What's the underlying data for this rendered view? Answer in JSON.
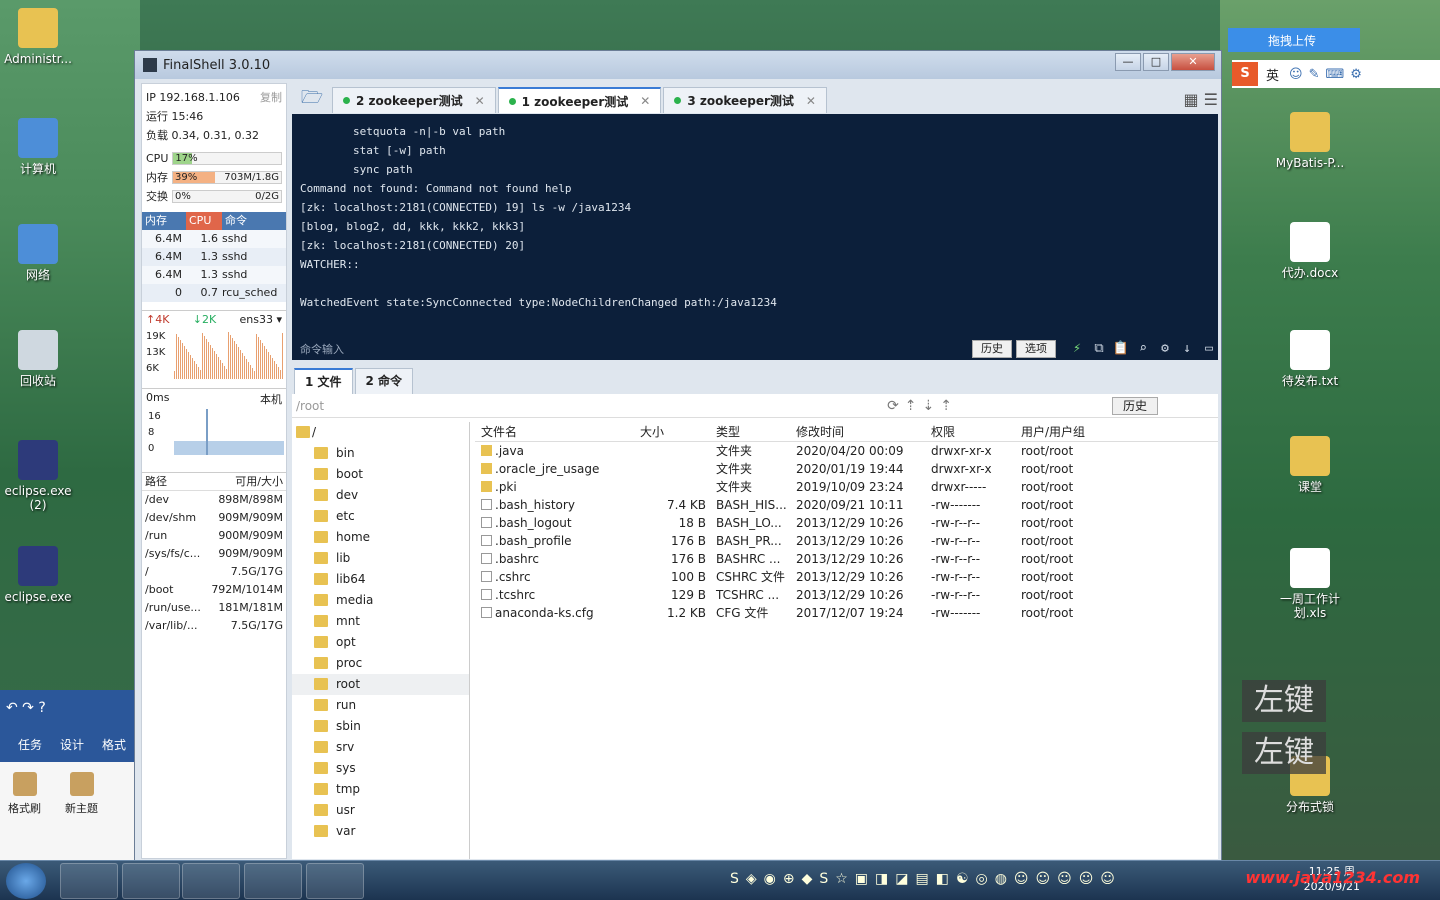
{
  "desktop": {
    "left_icons": [
      {
        "name": "user-folder-icon",
        "label": "Administr..."
      },
      {
        "name": "computer-icon",
        "label": "计算机"
      },
      {
        "name": "network-icon",
        "label": "网络"
      },
      {
        "name": "recycle-bin-icon",
        "label": "回收站"
      },
      {
        "name": "eclipse-icon",
        "label": "eclipse.exe (2)"
      },
      {
        "name": "eclipse-icon",
        "label": "eclipse.exe"
      }
    ],
    "right_icons": [
      {
        "name": "folder-icon",
        "label": "MyBatis-P..."
      },
      {
        "name": "word-doc-icon",
        "label": "代办.docx"
      },
      {
        "name": "text-file-icon",
        "label": "待发布.txt"
      },
      {
        "name": "folder-icon",
        "label": "课堂"
      },
      {
        "name": "spreadsheet-icon",
        "label": "一周工作计划.xls"
      },
      {
        "name": "folder-icon",
        "label": "分布式锁"
      }
    ],
    "baidu_label": "拖拽上传",
    "ime_label": "英",
    "overlay_text": "左键"
  },
  "window": {
    "title": "FinalShell 3.0.10",
    "controls": {
      "min": "—",
      "max": "□",
      "close": "✕"
    }
  },
  "sysinfo": {
    "ip": "IP 192.168.1.106",
    "copy": "复制",
    "uptime": "运行 15:46",
    "load": "负载 0.34, 0.31, 0.32",
    "cpu": {
      "label": "CPU",
      "value": "17%",
      "pct": 0.17
    },
    "mem": {
      "label": "内存",
      "value": "39%",
      "detail": "703M/1.8G",
      "pct": 0.39
    },
    "swap": {
      "label": "交换",
      "value": "0%",
      "detail": "0/2G",
      "pct": 0
    },
    "proc_headers": [
      "内存",
      "CPU",
      "命令"
    ],
    "procs": [
      {
        "mem": "6.4M",
        "cpu": "1.6",
        "cmd": "sshd"
      },
      {
        "mem": "6.4M",
        "cpu": "1.3",
        "cmd": "sshd"
      },
      {
        "mem": "6.4M",
        "cpu": "1.3",
        "cmd": "sshd"
      },
      {
        "mem": "0",
        "cpu": "0.7",
        "cmd": "rcu_sched"
      }
    ],
    "net": {
      "up": "4K",
      "down": "2K",
      "iface": "ens33",
      "ticks": [
        "19K",
        "13K",
        "6K"
      ]
    },
    "ping": {
      "label": "0ms",
      "host": "本机",
      "ticks": [
        "16",
        "8",
        "0"
      ]
    },
    "disk_headers": [
      "路径",
      "可用/大小"
    ],
    "disks": [
      {
        "path": "/dev",
        "size": "898M/898M"
      },
      {
        "path": "/dev/shm",
        "size": "909M/909M"
      },
      {
        "path": "/run",
        "size": "900M/909M"
      },
      {
        "path": "/sys/fs/c...",
        "size": "909M/909M"
      },
      {
        "path": "/",
        "size": "7.5G/17G"
      },
      {
        "path": "/boot",
        "size": "792M/1014M"
      },
      {
        "path": "/run/use...",
        "size": "181M/181M"
      },
      {
        "path": "/var/lib/...",
        "size": "7.5G/17G"
      }
    ]
  },
  "tabs": [
    {
      "label": "2 zookeeper测试",
      "active": false
    },
    {
      "label": "1 zookeeper测试",
      "active": true
    },
    {
      "label": "3 zookeeper测试",
      "active": false
    }
  ],
  "terminal": {
    "text": "        setquota -n|-b val path\n        stat [-w] path\n        sync path\nCommand not found: Command not found help\n[zk: localhost:2181(CONNECTED) 19] ls -w /java1234\n[blog, blog2, dd, kkk, kkk2, kkk3]\n[zk: localhost:2181(CONNECTED) 20]\nWATCHER::\n\nWatchedEvent state:SyncConnected type:NodeChildrenChanged path:/java1234",
    "input_placeholder": "命令输入",
    "history_btn": "历史",
    "options_btn": "选项"
  },
  "filemanager": {
    "tabs": [
      "1 文件",
      "2 命令"
    ],
    "path": "/root",
    "history_btn": "历史",
    "tree": [
      "/",
      "bin",
      "boot",
      "dev",
      "etc",
      "home",
      "lib",
      "lib64",
      "media",
      "mnt",
      "opt",
      "proc",
      "root",
      "run",
      "sbin",
      "srv",
      "sys",
      "tmp",
      "usr",
      "var"
    ],
    "headers": [
      "文件名",
      "大小",
      "类型",
      "修改时间",
      "权限",
      "用户/用户组"
    ],
    "files": [
      {
        "name": ".java",
        "size": "",
        "type": "文件夹",
        "mtime": "2020/04/20 00:09",
        "perm": "drwxr-xr-x",
        "owner": "root/root",
        "dir": true
      },
      {
        "name": ".oracle_jre_usage",
        "size": "",
        "type": "文件夹",
        "mtime": "2020/01/19 19:44",
        "perm": "drwxr-xr-x",
        "owner": "root/root",
        "dir": true
      },
      {
        "name": ".pki",
        "size": "",
        "type": "文件夹",
        "mtime": "2019/10/09 23:24",
        "perm": "drwxr-----",
        "owner": "root/root",
        "dir": true
      },
      {
        "name": ".bash_history",
        "size": "7.4 KB",
        "type": "BASH_HIS...",
        "mtime": "2020/09/21 10:11",
        "perm": "-rw-------",
        "owner": "root/root",
        "dir": false
      },
      {
        "name": ".bash_logout",
        "size": "18 B",
        "type": "BASH_LO...",
        "mtime": "2013/12/29 10:26",
        "perm": "-rw-r--r--",
        "owner": "root/root",
        "dir": false
      },
      {
        "name": ".bash_profile",
        "size": "176 B",
        "type": "BASH_PR...",
        "mtime": "2013/12/29 10:26",
        "perm": "-rw-r--r--",
        "owner": "root/root",
        "dir": false
      },
      {
        "name": ".bashrc",
        "size": "176 B",
        "type": "BASHRC ...",
        "mtime": "2013/12/29 10:26",
        "perm": "-rw-r--r--",
        "owner": "root/root",
        "dir": false
      },
      {
        "name": ".cshrc",
        "size": "100 B",
        "type": "CSHRC 文件",
        "mtime": "2013/12/29 10:26",
        "perm": "-rw-r--r--",
        "owner": "root/root",
        "dir": false
      },
      {
        "name": ".tcshrc",
        "size": "129 B",
        "type": "TCSHRC ...",
        "mtime": "2013/12/29 10:26",
        "perm": "-rw-r--r--",
        "owner": "root/root",
        "dir": false
      },
      {
        "name": "anaconda-ks.cfg",
        "size": "1.2 KB",
        "type": "CFG 文件",
        "mtime": "2017/12/07 19:24",
        "perm": "-rw-------",
        "owner": "root/root",
        "dir": false
      }
    ]
  },
  "word": {
    "tabs": [
      "任务",
      "设计",
      "格式"
    ],
    "tools": [
      "格式刷",
      "新主题"
    ]
  },
  "taskbar": {
    "time": "11:25 周",
    "date": "2020/9/21",
    "watermark": "www.java1234.com"
  },
  "colors": {
    "terminal_bg": "#0c1f3a",
    "accent": "#3a7bd5",
    "tab_dot": "#2bb24c",
    "proc_header": "#4a78b0"
  }
}
